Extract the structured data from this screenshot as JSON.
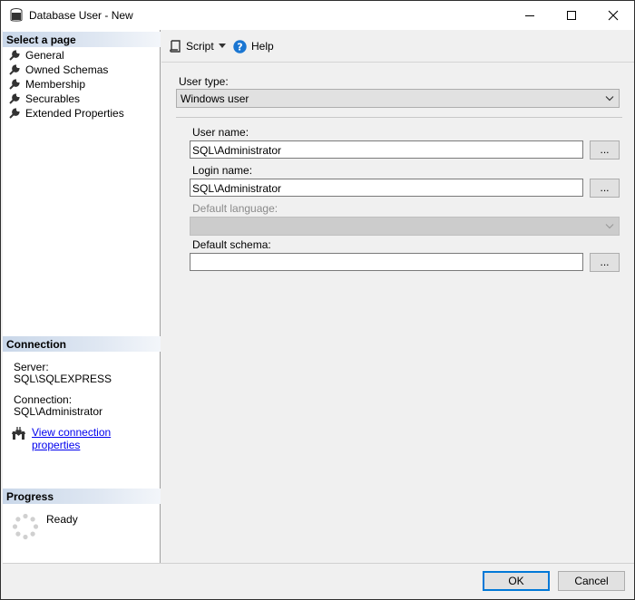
{
  "window": {
    "title": "Database User - New",
    "icon": "database-icon"
  },
  "sidebar": {
    "select_page_header": "Select a page",
    "pages": [
      {
        "label": "General",
        "icon": "wrench-icon"
      },
      {
        "label": "Owned Schemas",
        "icon": "wrench-icon"
      },
      {
        "label": "Membership",
        "icon": "wrench-icon"
      },
      {
        "label": "Securables",
        "icon": "wrench-icon"
      },
      {
        "label": "Extended Properties",
        "icon": "wrench-icon"
      }
    ],
    "connection_header": "Connection",
    "server_label": "Server:",
    "server_value": "SQL\\SQLEXPRESS",
    "connection_label": "Connection:",
    "connection_value": "SQL\\Administrator",
    "view_connection_link": "View connection properties",
    "progress_header": "Progress",
    "progress_status": "Ready"
  },
  "toolbar": {
    "script_label": "Script",
    "help_label": "Help"
  },
  "form": {
    "user_type_label": "User type:",
    "user_type_value": "Windows user",
    "user_name_label": "User name:",
    "user_name_value": "SQL\\Administrator",
    "login_name_label": "Login name:",
    "login_name_value": "SQL\\Administrator",
    "default_language_label": "Default language:",
    "default_language_value": "",
    "default_schema_label": "Default schema:",
    "default_schema_value": "",
    "browse_label": "..."
  },
  "buttons": {
    "ok": "OK",
    "cancel": "Cancel"
  },
  "colors": {
    "accent": "#0078d7",
    "link": "#0000ee",
    "help_icon": "#1a76d2"
  }
}
